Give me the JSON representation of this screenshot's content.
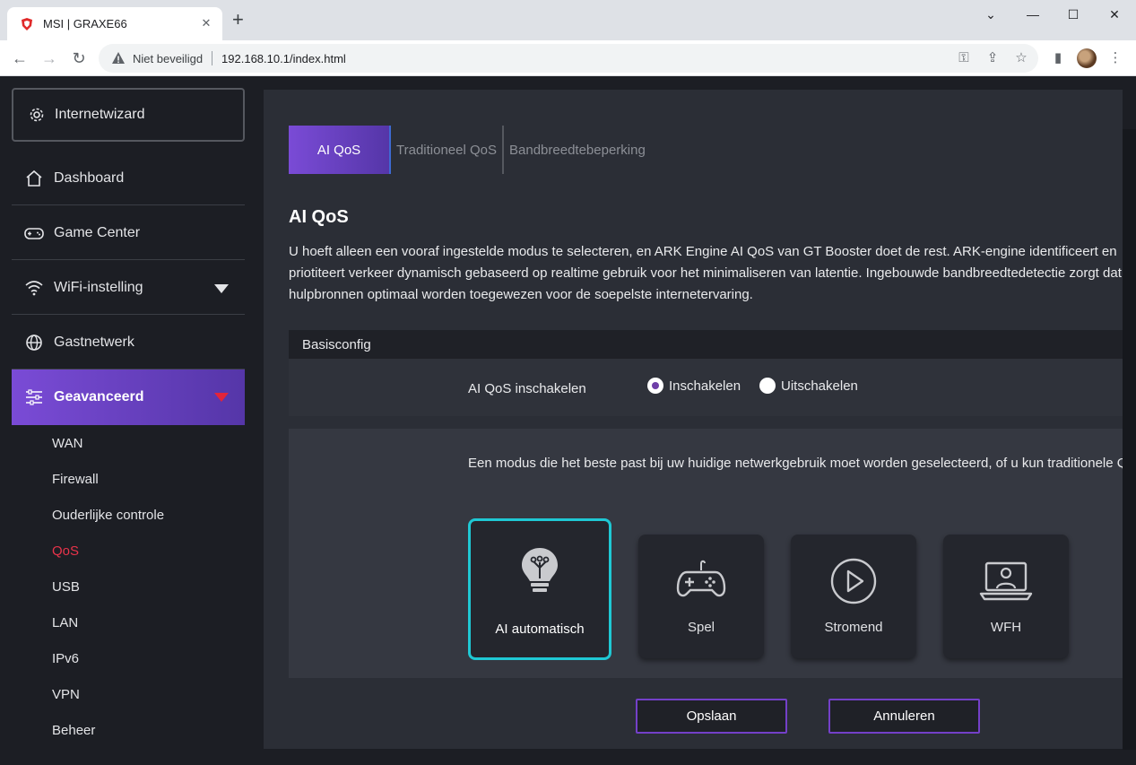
{
  "browser": {
    "tab_title": "MSI | GRAXE66",
    "security_label": "Niet beveiligd",
    "url": "192.168.10.1/index.html"
  },
  "sidebar": {
    "wizard_label": "Internetwizard",
    "items": [
      {
        "label": "Dashboard",
        "icon": "home-icon"
      },
      {
        "label": "Game Center",
        "icon": "gamepad-icon"
      },
      {
        "label": "WiFi-instelling",
        "icon": "wifi-icon"
      },
      {
        "label": "Gastnetwerk",
        "icon": "globe-icon"
      },
      {
        "label": "Geavanceerd",
        "icon": "sliders-icon"
      }
    ],
    "sub_items": [
      "WAN",
      "Firewall",
      "Ouderlijke controle",
      "QoS",
      "USB",
      "LAN",
      "IPv6",
      "VPN",
      "Beheer"
    ],
    "active_sub": "QoS"
  },
  "tabs": [
    "AI QoS",
    "Traditioneel QoS",
    "Bandbreedtebeperking"
  ],
  "main": {
    "title": "AI QoS",
    "description_lines": [
      "U hoeft alleen een vooraf ingestelde modus te selecteren, en ARK Engine AI QoS van GT Booster doet de rest. ARK-engine identificeert en",
      "priotiteert verkeer dynamisch gebaseerd op realtime gebruik voor het minimaliseren van latentie. Ingebouwde bandbreedtedetectie zorgt dat",
      "hulpbronnen optimaal worden toegewezen voor de soepelste internetervaring."
    ],
    "section_title": "Basisconfig",
    "enable_label": "AI QoS inschakelen",
    "radio_on": "Inschakelen",
    "radio_off": "Uitschakelen",
    "mode_text": "Een modus die het beste past bij uw huidige netwerkgebruik moet worden geselecteerd, of u kun traditionele QoS gebruiken.",
    "modes": [
      {
        "label": "AI automatisch",
        "icon": "lightbulb-icon"
      },
      {
        "label": "Spel",
        "icon": "gamepad-icon"
      },
      {
        "label": "Stromend",
        "icon": "play-icon"
      },
      {
        "label": "WFH",
        "icon": "laptop-user-icon"
      }
    ],
    "save_label": "Opslaan",
    "cancel_label": "Annuleren"
  },
  "colors": {
    "accent_purple": "#7a4bd6",
    "selected_border": "#1fc8d4",
    "active_sub_red": "#e8334a"
  }
}
